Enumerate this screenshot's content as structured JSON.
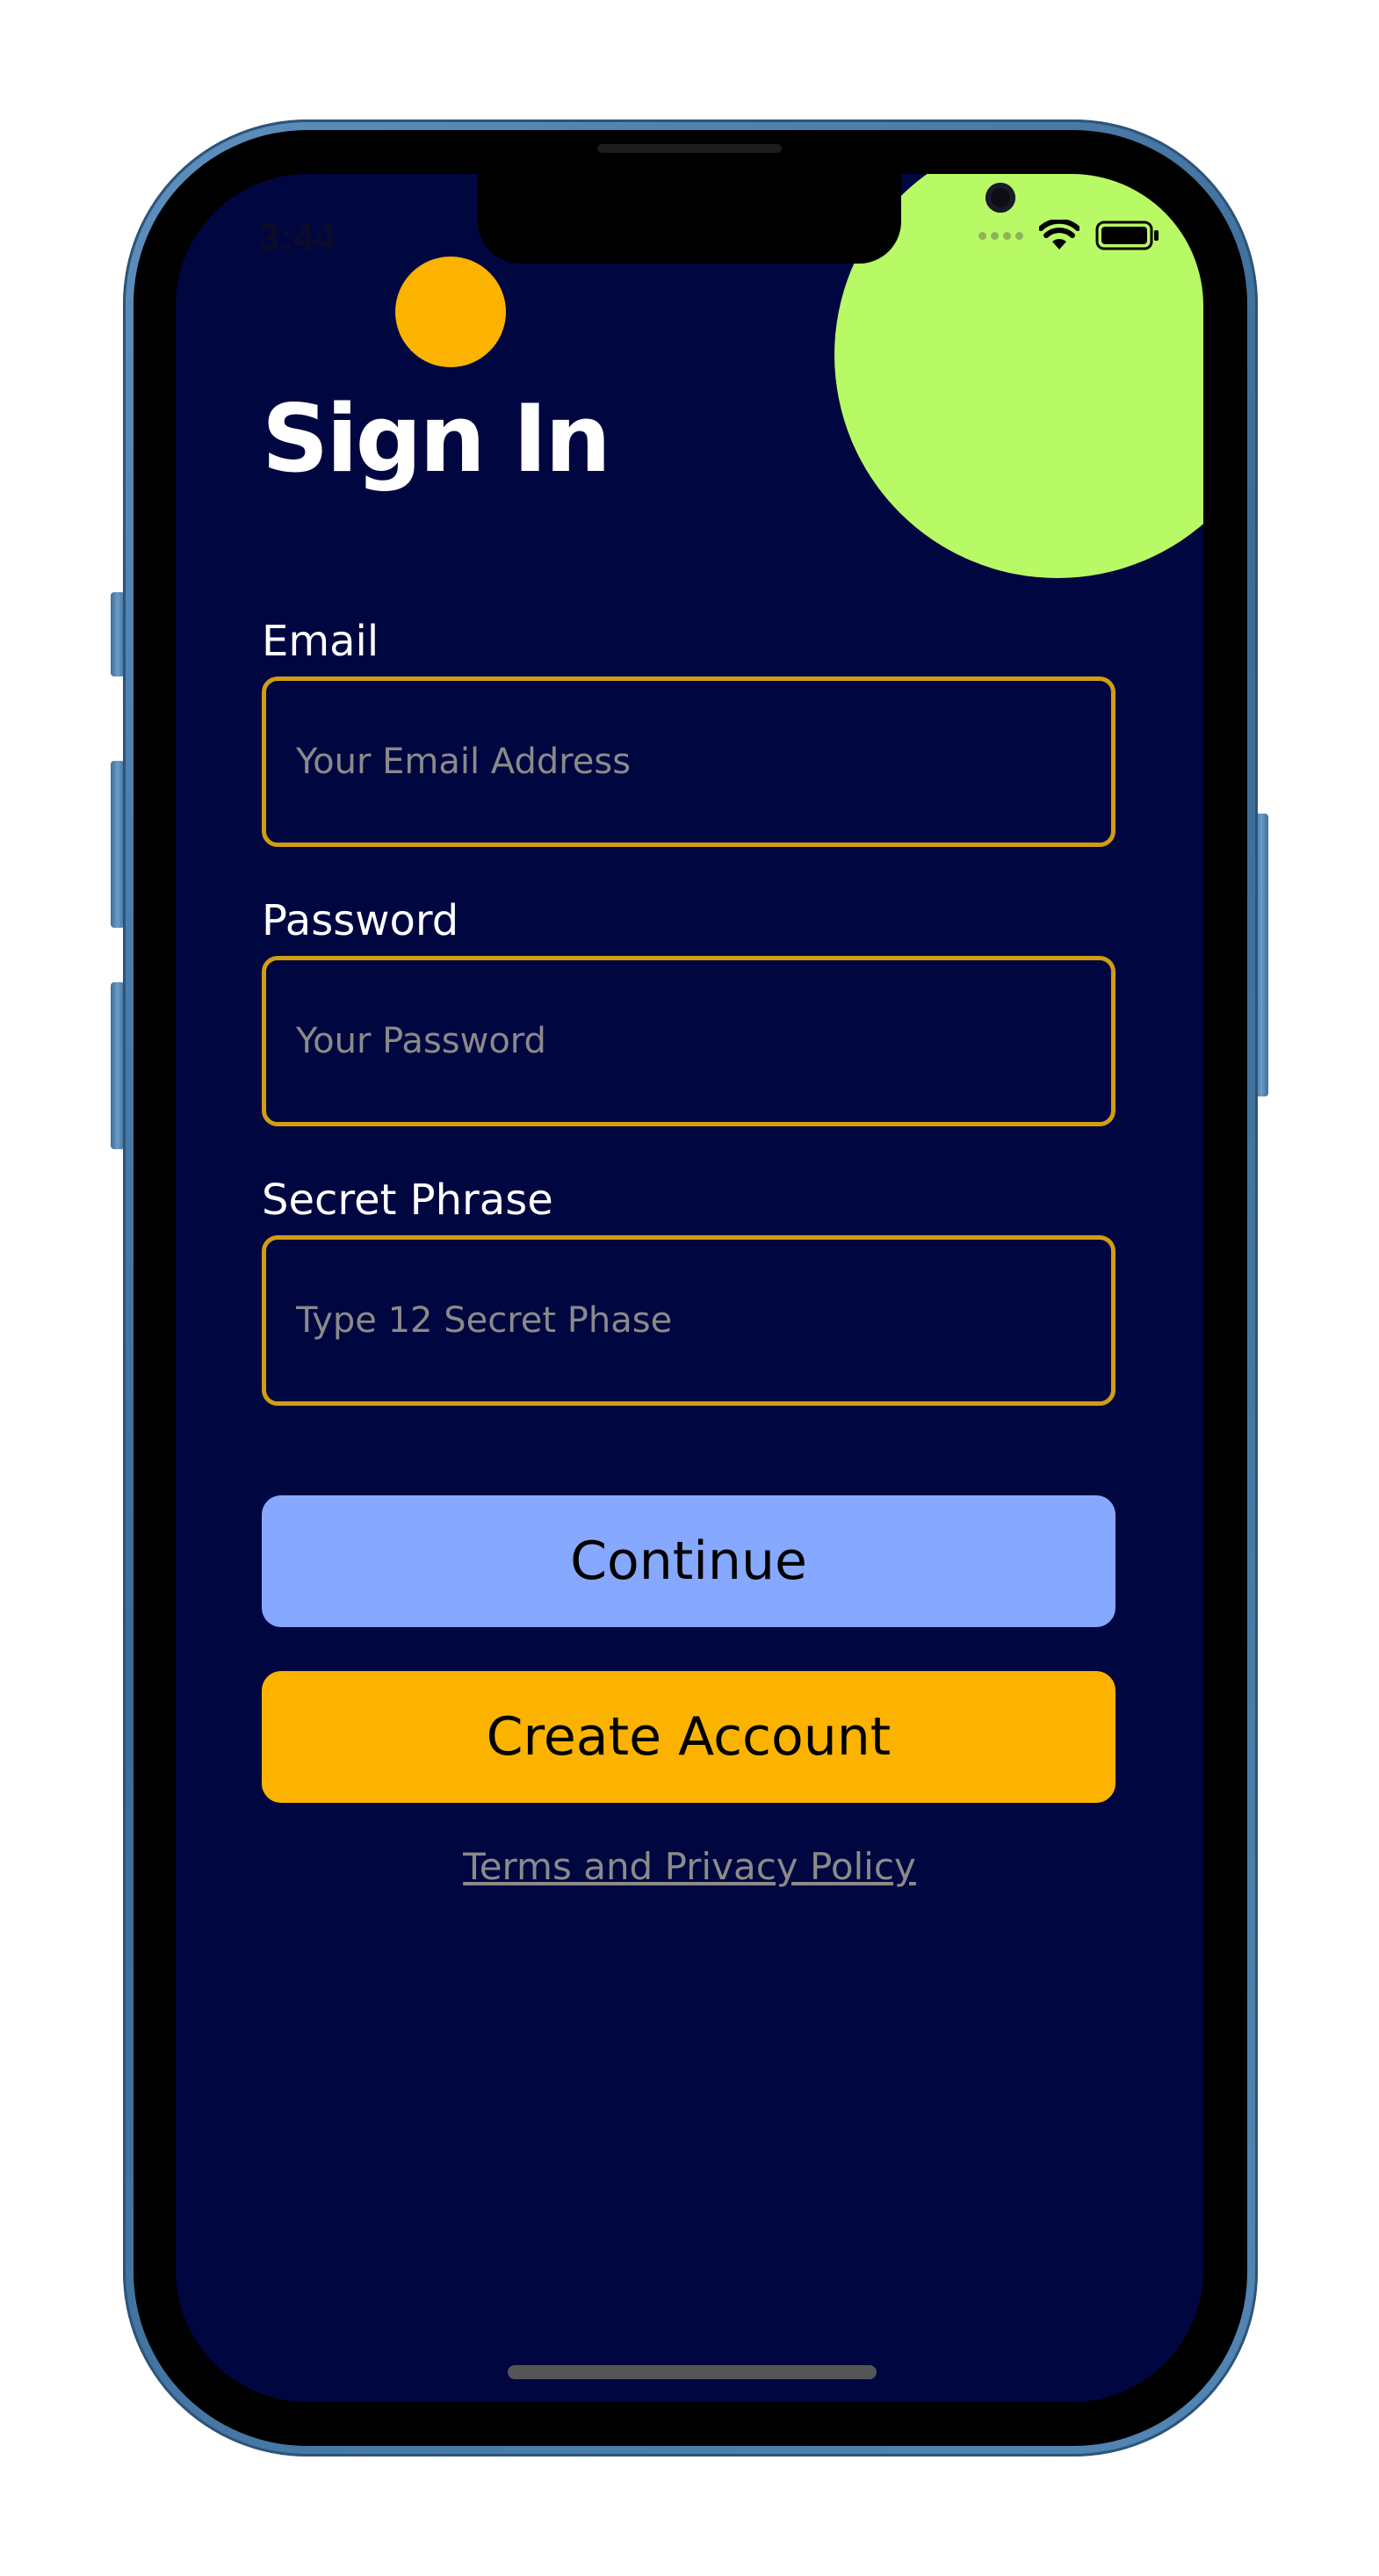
{
  "status_bar": {
    "time": "3:44",
    "signal_icon": "cellular-signal-icon",
    "wifi_icon": "wifi-icon",
    "battery_icon": "battery-icon"
  },
  "screen": {
    "title": "Sign In",
    "fields": [
      {
        "label": "Email",
        "placeholder": "Your Email Address",
        "value": ""
      },
      {
        "label": "Password",
        "placeholder": "Your Password",
        "value": ""
      },
      {
        "label": "Secret Phrase",
        "placeholder": "Type 12 Secret Phase",
        "value": ""
      }
    ],
    "buttons": {
      "continue": "Continue",
      "create_account": "Create Account"
    },
    "terms_link": "Terms and Privacy Policy"
  },
  "colors": {
    "background": "#000640",
    "accent_green": "#b8f966",
    "accent_orange": "#fbb300",
    "field_border": "#d19e12",
    "continue_button": "#86a8ff",
    "placeholder_text": "#8a8a8a"
  }
}
